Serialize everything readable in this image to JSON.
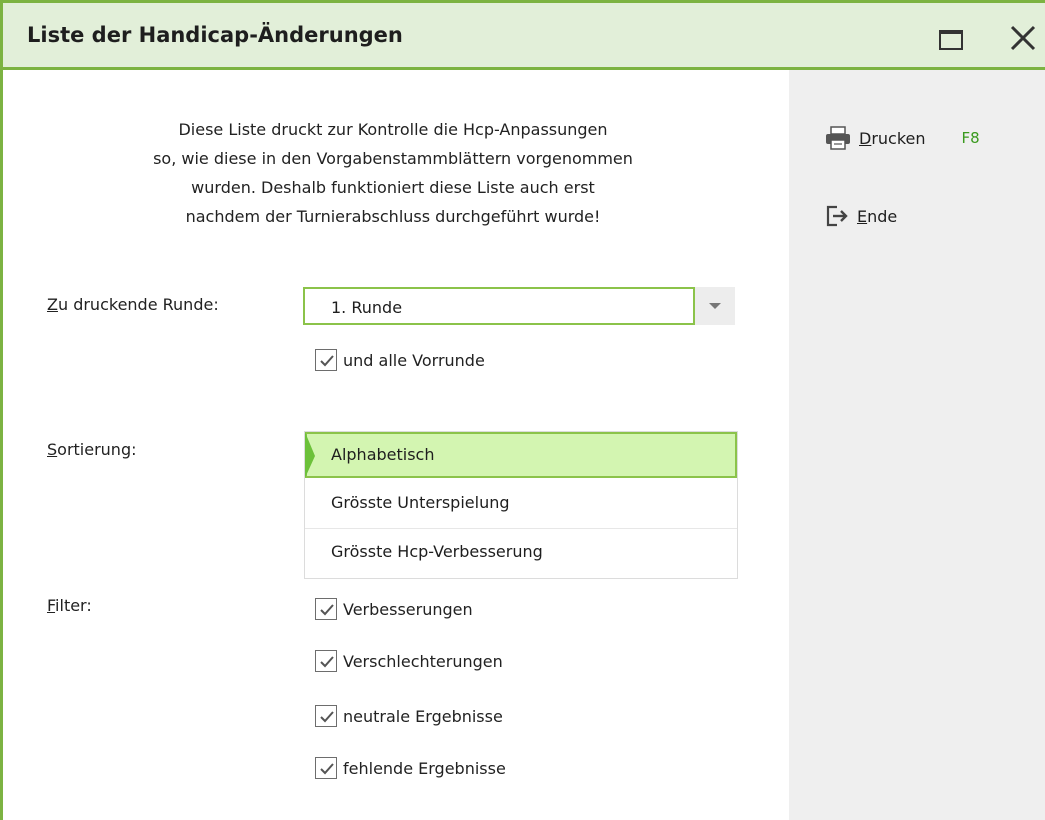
{
  "window": {
    "title": "Liste der Handicap-Änderungen"
  },
  "intro_text": "Diese Liste druckt zur Kontrolle die Hcp-Anpassungen\nso, wie diese in den Vorgabenstammblättern vorgenommen\nwurden. Deshalb funktioniert diese Liste auch erst\nnachdem der Turnierabschluss durchgeführt wurde!",
  "runde": {
    "label_mnemonic": "Z",
    "label_rest": "u druckende Runde:",
    "selected": "1. Runde",
    "include_previous_label": "und alle Vorrunde",
    "include_previous_checked": true
  },
  "sortierung": {
    "label_mnemonic": "S",
    "label_rest": "ortierung:",
    "options": [
      "Alphabetisch",
      "Grösste Unterspielung",
      "Grösste Hcp-Verbesserung"
    ],
    "selected": "Alphabetisch"
  },
  "filter": {
    "label_mnemonic": "F",
    "label_rest": "ilter:",
    "items": [
      {
        "label": "Verbesserungen",
        "checked": true
      },
      {
        "label": "Verschlechterungen",
        "checked": true
      },
      {
        "label": "neutrale Ergebnisse",
        "checked": true
      },
      {
        "label": "fehlende Ergebnisse",
        "checked": true
      }
    ]
  },
  "actions": {
    "print_mnemonic": "D",
    "print_rest": "rucken",
    "print_shortcut": "F8",
    "end_mnemonic": "E",
    "end_rest": "nde"
  },
  "icons": {
    "print": "printer-icon",
    "end": "exit-icon",
    "maximize": "maximize-icon",
    "close": "close-icon"
  },
  "colors": {
    "accent": "#7cb342",
    "title_bg": "#e2efd9",
    "selected_bg": "#d3f5b1",
    "shortcut": "#3a9a1e",
    "side_panel": "#efefef"
  }
}
